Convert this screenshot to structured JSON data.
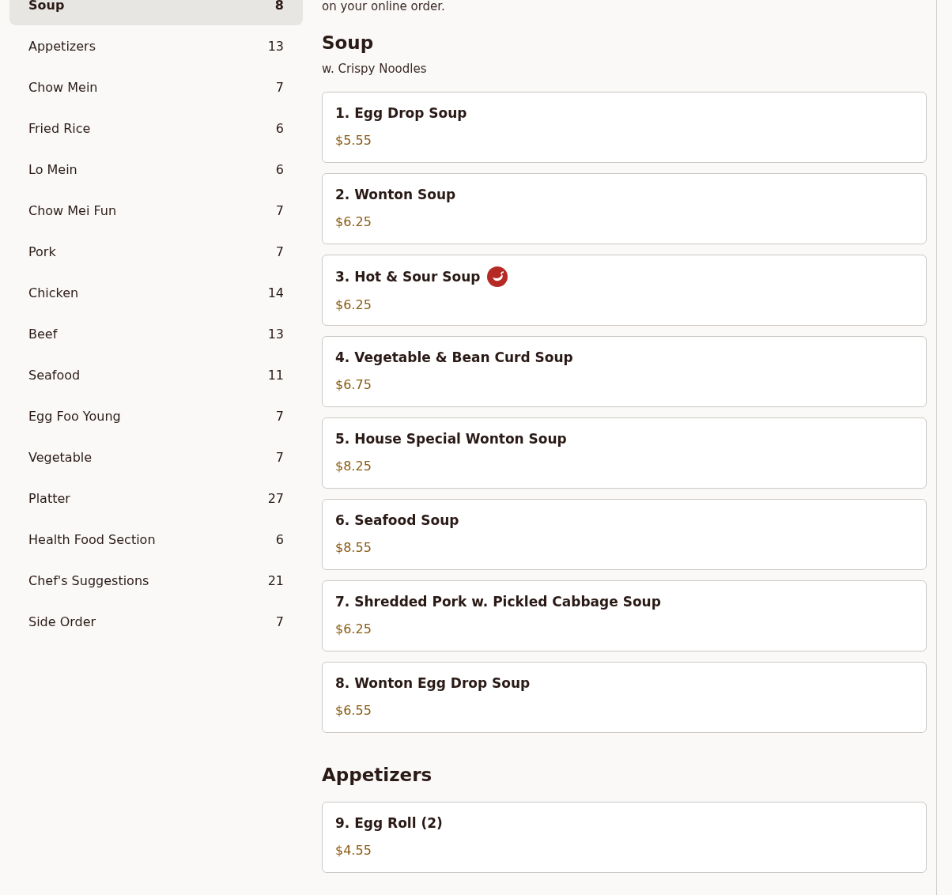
{
  "sidebar": {
    "categories": [
      {
        "name": "Soup",
        "count": "8",
        "selected": true
      },
      {
        "name": "Appetizers",
        "count": "13",
        "selected": false
      },
      {
        "name": "Chow Mein",
        "count": "7",
        "selected": false
      },
      {
        "name": "Fried Rice",
        "count": "6",
        "selected": false
      },
      {
        "name": "Lo Mein",
        "count": "6",
        "selected": false
      },
      {
        "name": "Chow Mei Fun",
        "count": "7",
        "selected": false
      },
      {
        "name": "Pork",
        "count": "7",
        "selected": false
      },
      {
        "name": "Chicken",
        "count": "14",
        "selected": false
      },
      {
        "name": "Beef",
        "count": "13",
        "selected": false
      },
      {
        "name": "Seafood",
        "count": "11",
        "selected": false
      },
      {
        "name": "Egg Foo Young",
        "count": "7",
        "selected": false
      },
      {
        "name": "Vegetable",
        "count": "7",
        "selected": false
      },
      {
        "name": "Platter",
        "count": "27",
        "selected": false
      },
      {
        "name": "Health Food Section",
        "count": "6",
        "selected": false
      },
      {
        "name": "Chef's Suggestions",
        "count": "21",
        "selected": false
      },
      {
        "name": "Side Order",
        "count": "7",
        "selected": false
      }
    ]
  },
  "note": "on your online order.",
  "sections": [
    {
      "title": "Soup",
      "subtitle": "w. Crispy Noodles",
      "items": [
        {
          "name": "1. Egg Drop Soup",
          "price": "$5.55",
          "spicy": false
        },
        {
          "name": "2. Wonton Soup",
          "price": "$6.25",
          "spicy": false
        },
        {
          "name": "3. Hot & Sour Soup",
          "price": "$6.25",
          "spicy": true
        },
        {
          "name": "4. Vegetable & Bean Curd Soup",
          "price": "$6.75",
          "spicy": false
        },
        {
          "name": "5. House Special Wonton Soup",
          "price": "$8.25",
          "spicy": false
        },
        {
          "name": "6. Seafood Soup",
          "price": "$8.55",
          "spicy": false
        },
        {
          "name": "7. Shredded Pork w. Pickled Cabbage Soup",
          "price": "$6.25",
          "spicy": false
        },
        {
          "name": "8. Wonton Egg Drop Soup",
          "price": "$6.55",
          "spicy": false
        }
      ]
    },
    {
      "title": "Appetizers",
      "items": [
        {
          "name": "9. Egg Roll (2)",
          "price": "$4.55",
          "spicy": false
        }
      ]
    }
  ]
}
